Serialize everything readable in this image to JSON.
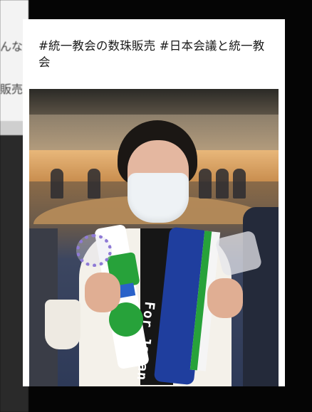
{
  "post": {
    "title": "#統一教会の数珠販売 #日本会議と統一教会",
    "subtitle_partial": "",
    "image_caption_text": "For Japan"
  },
  "background": {
    "fragment_1": "んな",
    "fragment_2": "販売"
  },
  "colors": {
    "page_background": "#050505",
    "card_background": "#ffffff",
    "scarf_blue": "#1f3e9e",
    "towel_green": "#27a23a"
  }
}
